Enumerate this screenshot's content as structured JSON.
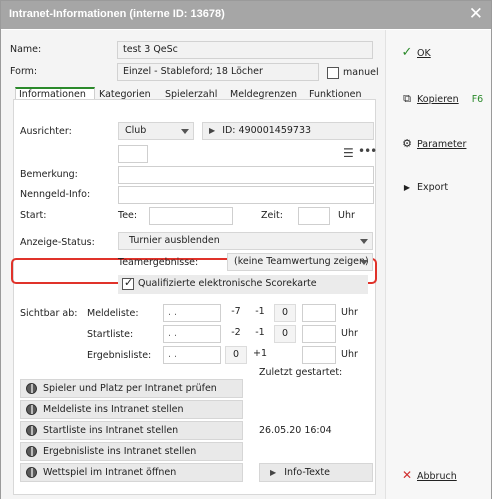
{
  "window": {
    "title": "Intranet-Informationen (interne ID: 13678)"
  },
  "header": {
    "name_label": "Name:",
    "name_value": "test 3 QeSc",
    "form_label": "Form:",
    "form_value": "Einzel - Stableford; 18 Löcher",
    "manuel_label": "manuel"
  },
  "tabs": [
    {
      "label": "Informationen"
    },
    {
      "label": "Kategorien"
    },
    {
      "label": "Spielerzahl"
    },
    {
      "label": "Meldegrenzen"
    },
    {
      "label": "Funktionen"
    }
  ],
  "info": {
    "ausrichter_label": "Ausrichter:",
    "ausrichter_value": "Club",
    "id_text": "ID: 490001459733",
    "bemerkung_label": "Bemerkung:",
    "nenngeld_label": "Nenngeld-Info:",
    "start_label": "Start:",
    "tee_label": "Tee:",
    "zeit_label": "Zeit:",
    "uhr": "Uhr",
    "anzeige_label": "Anzeige-Status:",
    "anzeige_value": "Turnier ausblenden",
    "teamergebnisse_label": "Teamergebnisse:",
    "teamergebnisse_value": "(keine Teamwertung zeigen)",
    "qualifiziert_label": "Qualifizierte elektronische Scorekarte",
    "sichtbar_label": "Sichtbar ab:",
    "meldeliste_label": "Meldeliste:",
    "startliste_label": "Startliste:",
    "ergebnisliste_label": "Ergebnisliste:",
    "date_placeholder": ". .",
    "meldeliste_nums": [
      "-7",
      "-1",
      "0"
    ],
    "startliste_nums": [
      "-2",
      "-1",
      "0"
    ],
    "ergebnisliste_nums": [
      "0",
      "+1"
    ],
    "zuletzt_label": "Zuletzt gestartet:",
    "zuletzt_value": "26.05.20 16:04",
    "info_texte_label": "Info-Texte"
  },
  "actions": [
    {
      "label": "Spieler und Platz per Intranet prüfen"
    },
    {
      "label": "Meldeliste ins Intranet stellen"
    },
    {
      "label": "Startliste ins Intranet stellen"
    },
    {
      "label": "Ergebnisliste ins Intranet stellen"
    },
    {
      "label": "Wettspiel im Intranet öffnen"
    }
  ],
  "sidebar": {
    "ok": "OK",
    "kopieren": "Kopieren",
    "kopieren_shortcut": "F6",
    "parameter": "Parameter",
    "export": "Export",
    "abbruch": "Abbruch"
  },
  "colors": {
    "highlight": "#e0322a",
    "ok_green": "#2b8a2b",
    "cancel_red": "#d03030"
  }
}
